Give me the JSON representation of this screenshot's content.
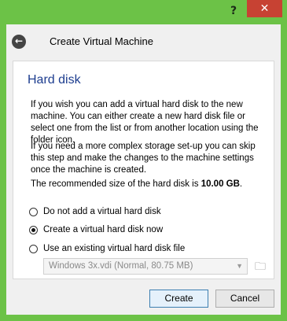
{
  "window": {
    "help_label": "?",
    "close_label": "✕"
  },
  "header": {
    "title": "Create Virtual Machine",
    "back_icon": "arrow-left"
  },
  "page": {
    "title": "Hard disk",
    "paragraph1": "If you wish you can add a virtual hard disk to the new machine. You can either create a new hard disk file or select one from the list or from another location using the folder icon.",
    "paragraph2": "If you need a more complex storage set-up you can skip this step and make the changes to the machine settings once the machine is created.",
    "recommended_prefix": "The recommended size of the hard disk is ",
    "recommended_value": "10.00 GB",
    "recommended_suffix": "."
  },
  "options": [
    {
      "label": "Do not add a virtual hard disk",
      "checked": false
    },
    {
      "label": "Create a virtual hard disk now",
      "checked": true
    },
    {
      "label": "Use an existing virtual hard disk file",
      "checked": false
    }
  ],
  "existing_disk": {
    "selected": "Windows 3x.vdi (Normal, 80.75 MB)",
    "enabled": false
  },
  "footer": {
    "create_label": "Create",
    "cancel_label": "Cancel"
  },
  "colors": {
    "frame": "#6cc247",
    "close": "#c74233",
    "title": "#1d3d8f"
  }
}
